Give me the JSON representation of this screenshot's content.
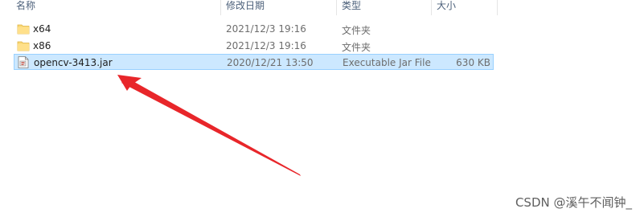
{
  "columns": {
    "name": "名称",
    "date_modified": "修改日期",
    "type": "类型",
    "size": "大小"
  },
  "files": [
    {
      "name": "x64",
      "date": "2021/12/3 19:16",
      "type": "文件夹",
      "size": "",
      "icon": "folder-icon"
    },
    {
      "name": "x86",
      "date": "2021/12/3 19:16",
      "type": "文件夹",
      "size": "",
      "icon": "folder-icon"
    },
    {
      "name": "opencv-3413.jar",
      "date": "2020/12/21 13:50",
      "type": "Executable Jar File",
      "size": "630 KB",
      "icon": "jar-file-icon",
      "selected": true
    }
  ],
  "watermark": "CSDN @溪午不闻钟_",
  "colors": {
    "selection_bg": "#cce8ff",
    "selection_border": "#99d1ff",
    "folder": "#f8d775",
    "arrow": "#e8262a"
  }
}
